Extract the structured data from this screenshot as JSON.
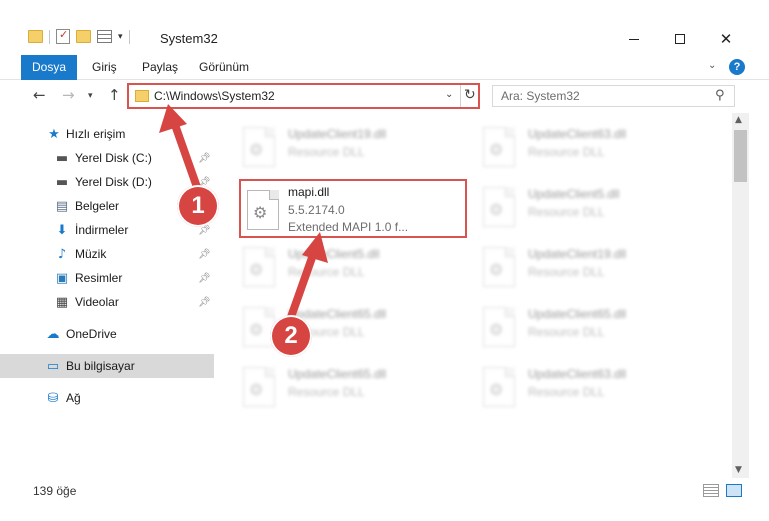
{
  "window": {
    "title": "System32",
    "min_icon": "minimize-icon",
    "max_icon": "maximize-icon",
    "close_icon": "close-icon"
  },
  "ribbon": {
    "tabs": [
      {
        "label": "Dosya",
        "active": true
      },
      {
        "label": "Giriş"
      },
      {
        "label": "Paylaş"
      },
      {
        "label": "Görünüm"
      }
    ],
    "help": "?"
  },
  "navigation": {
    "back_icon": "back-arrow-icon",
    "forward_icon": "forward-arrow-icon",
    "up_icon": "up-arrow-icon",
    "address": "C:\\Windows\\System32",
    "search_placeholder": "Ara: System32"
  },
  "sidebar": {
    "items": [
      {
        "label": "Hızlı erişim",
        "icon": "star-icon"
      },
      {
        "label": "Yerel Disk (C:)",
        "icon": "drive-icon",
        "pinned": true
      },
      {
        "label": "Yerel Disk (D:)",
        "icon": "drive-icon",
        "pinned": true
      },
      {
        "label": "Belgeler",
        "icon": "documents-icon",
        "pinned": true
      },
      {
        "label": "İndirmeler",
        "icon": "download-icon",
        "pinned": true
      },
      {
        "label": "Müzik",
        "icon": "music-icon",
        "pinned": true
      },
      {
        "label": "Resimler",
        "icon": "pictures-icon",
        "pinned": true
      },
      {
        "label": "Videolar",
        "icon": "videos-icon",
        "pinned": true
      },
      {
        "label": "OneDrive",
        "icon": "cloud-icon"
      },
      {
        "label": "Bu bilgisayar",
        "icon": "computer-icon",
        "selected": true
      },
      {
        "label": "Ağ",
        "icon": "network-icon"
      }
    ]
  },
  "files": [
    {
      "name": "UpdateClient19.dll",
      "line2": "Resource DLL",
      "line3": ""
    },
    {
      "name": "UpdateClient63.dll",
      "line2": "Resource DLL",
      "line3": ""
    },
    {
      "name": "mapi.dll",
      "line2": "5.5.2174.0",
      "line3": "Extended MAPI 1.0 f..."
    },
    {
      "name": "UpdateClient5.dll",
      "line2": "Resource DLL",
      "line3": ""
    },
    {
      "name": "UpdateClient5.dll",
      "line2": "Resource DLL",
      "line3": ""
    },
    {
      "name": "UpdateClient19.dll",
      "line2": "Resource DLL",
      "line3": ""
    },
    {
      "name": "UpdateClient65.dll",
      "line2": "Resource DLL",
      "line3": ""
    },
    {
      "name": "UpdateClient65.dll",
      "line2": "Resource DLL",
      "line3": ""
    },
    {
      "name": "UpdateClient65.dll",
      "line2": "Resource DLL",
      "line3": ""
    },
    {
      "name": "UpdateClient63.dll",
      "line2": "Resource DLL",
      "line3": ""
    }
  ],
  "status": {
    "item_count": "139 öğe"
  },
  "annotations": {
    "callout_1": "1",
    "callout_2": "2",
    "highlight_color": "#d9534f",
    "callout_color": "#d64541"
  },
  "colors": {
    "accent": "#1979ca"
  }
}
